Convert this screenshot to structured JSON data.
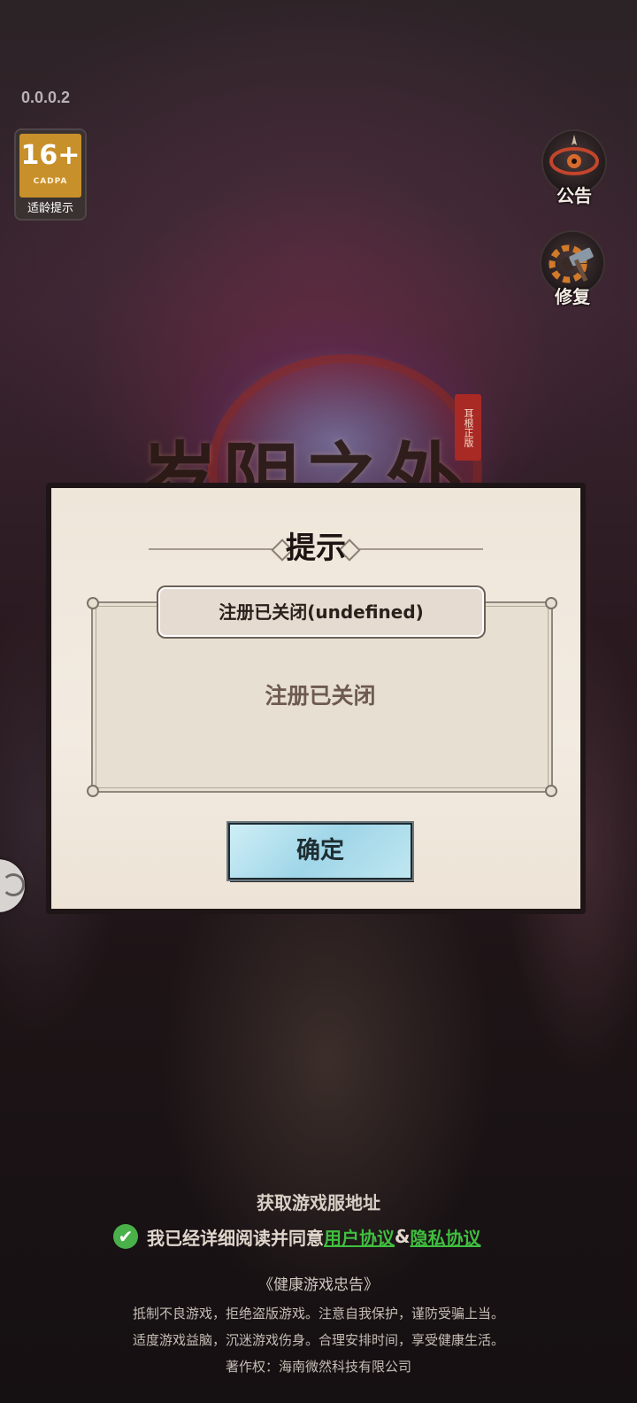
{
  "app": {
    "version": "0.0.0.2"
  },
  "age_rating": {
    "age": "16+",
    "org": "CADPA",
    "tip": "适龄提示"
  },
  "side_buttons": {
    "announcement": "公告",
    "repair": "修复"
  },
  "logo": {
    "title": "岁阴之外",
    "seal": "耳根正版"
  },
  "dialog": {
    "title": "提示",
    "header": "注册已关闭(undefined)",
    "message": "注册已关闭",
    "confirm_label": "确定"
  },
  "footer": {
    "server_link": "获取游戏服地址",
    "agree_prefix": "我已经详细阅读并同意",
    "user_agreement": "用户协议",
    "amp": "&",
    "privacy_policy": "隐私协议",
    "health_title": "《健康游戏忠告》",
    "health_lines": [
      "抵制不良游戏，拒绝盗版游戏。注意自我保护，谨防受骗上当。",
      "适度游戏益脑，沉迷游戏伤身。合理安排时间，享受健康生活。",
      "著作权：海南微然科技有限公司"
    ]
  },
  "colors": {
    "confirm_button": "#9fd6e8",
    "agree_check": "#4ab04a",
    "agreement_link": "#3fbf3f",
    "age_badge": "#c8902a"
  },
  "icons": {
    "announcement": "eye-icon",
    "repair": "gear-hammer-icon",
    "check": "check-icon",
    "float": "assistant-icon"
  }
}
